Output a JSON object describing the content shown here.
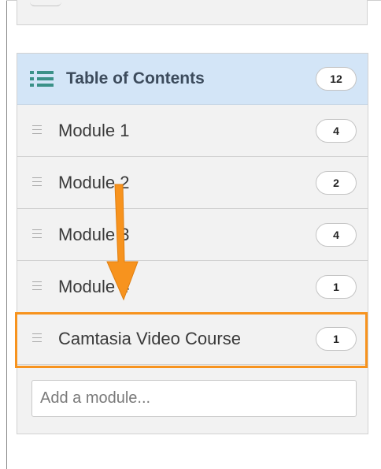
{
  "toc": {
    "title": "Table of Contents",
    "count": "12",
    "icon": "list-icon",
    "modules": [
      {
        "label": "Module 1",
        "count": "4"
      },
      {
        "label": "Module 2",
        "count": "2"
      },
      {
        "label": "Module 3",
        "count": "4"
      },
      {
        "label": "Module 4",
        "count": "1"
      },
      {
        "label": "Camtasia Video Course",
        "count": "1"
      }
    ],
    "add_module_placeholder": "Add a module..."
  },
  "colors": {
    "header_bg": "#d3e5f7",
    "panel_bg": "#f2f2f2",
    "highlight": "#f7931e",
    "arrow": "#f7931e",
    "icon": "#3b9188"
  }
}
